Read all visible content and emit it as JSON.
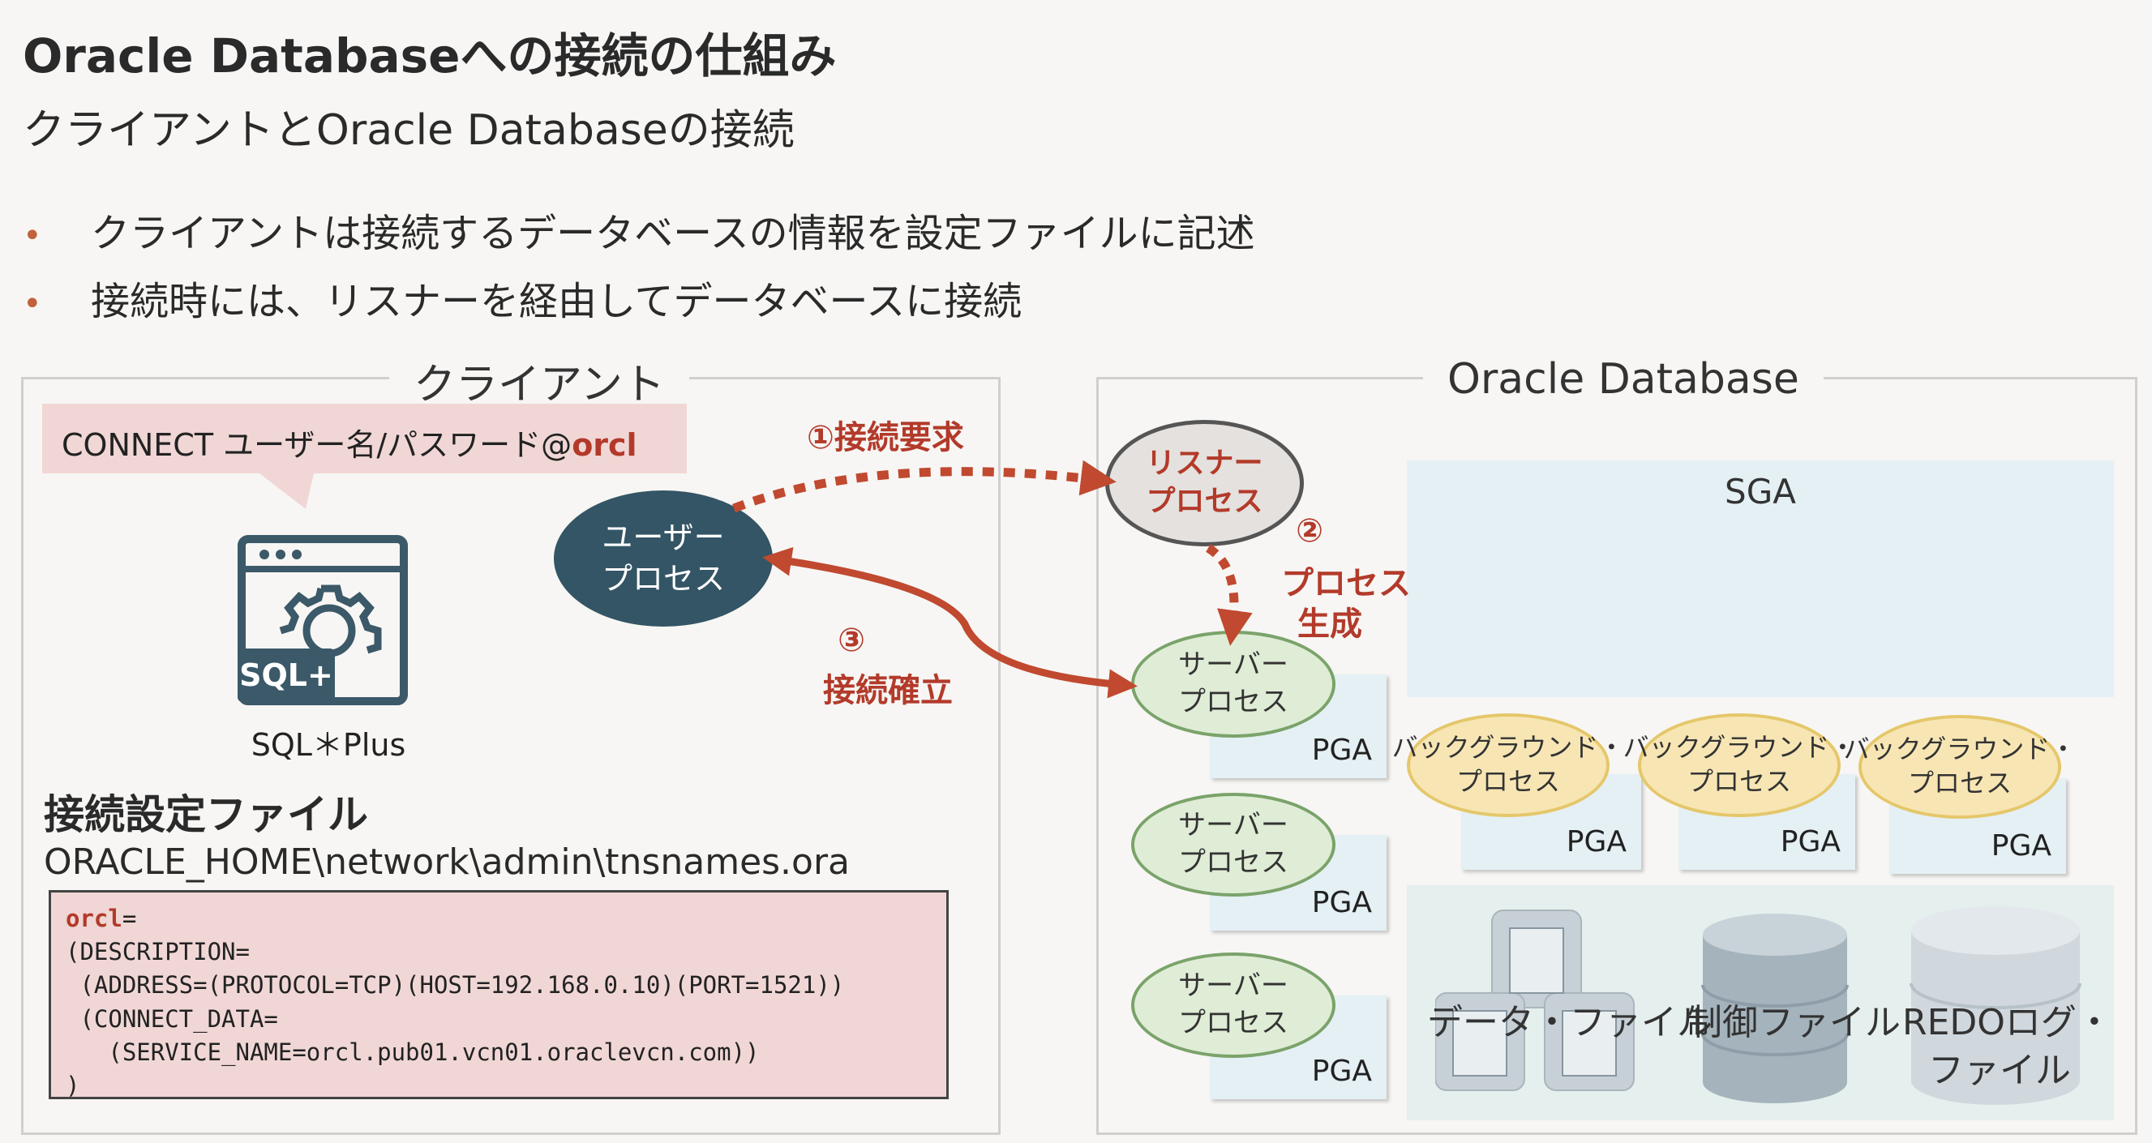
{
  "title": "Oracle Databaseへの接続の仕組み",
  "subtitle": "クライアントとOracle Databaseの接続",
  "bullets": [
    "クライアントは接続するデータベースの情報を設定ファイルに記述",
    "接続時には、リスナーを経由してデータベースに接続"
  ],
  "bullet_marker": "•",
  "client": {
    "title": "クライアント",
    "connect_prefix": "CONNECT ユーザー名/パスワード@",
    "connect_service": "orcl",
    "sqlplus_label": "SQL＊Plus",
    "sqlplus_badge": "SQL+",
    "user_process": "ユーザー\nプロセス",
    "config_heading": "接続設定ファイル",
    "config_path": "ORACLE_HOME\\network\\admin\\tnsnames.ora",
    "tns_alias": "orcl",
    "tns_lines": [
      "(DESCRIPTION=",
      " (ADDRESS=(PROTOCOL=TCP)(HOST=192.168.0.10)(PORT=1521))",
      " (CONNECT_DATA=",
      "   (SERVICE_NAME=orcl.pub01.vcn01.oraclevcn.com))",
      ")"
    ]
  },
  "steps": {
    "step1": "①接続要求",
    "step2_num": "②",
    "step2_text": "プロセス\n生成",
    "step3_num": "③",
    "step3_text": "接続確立"
  },
  "database": {
    "title": "Oracle Database",
    "listener": "リスナー\nプロセス",
    "sga": "SGA",
    "server_process": "サーバー\nプロセス",
    "pga": "PGA",
    "background_process": "バックグラウンド・\nプロセス",
    "data_file": "データ・ファイル",
    "control_file": "制御ファイル",
    "redo_file": "REDOログ・\nファイル"
  },
  "colors": {
    "accent_red": "#b33a2a",
    "user_process": "#335565",
    "server_border": "#7aa36a",
    "background_border": "#e5c76b"
  }
}
